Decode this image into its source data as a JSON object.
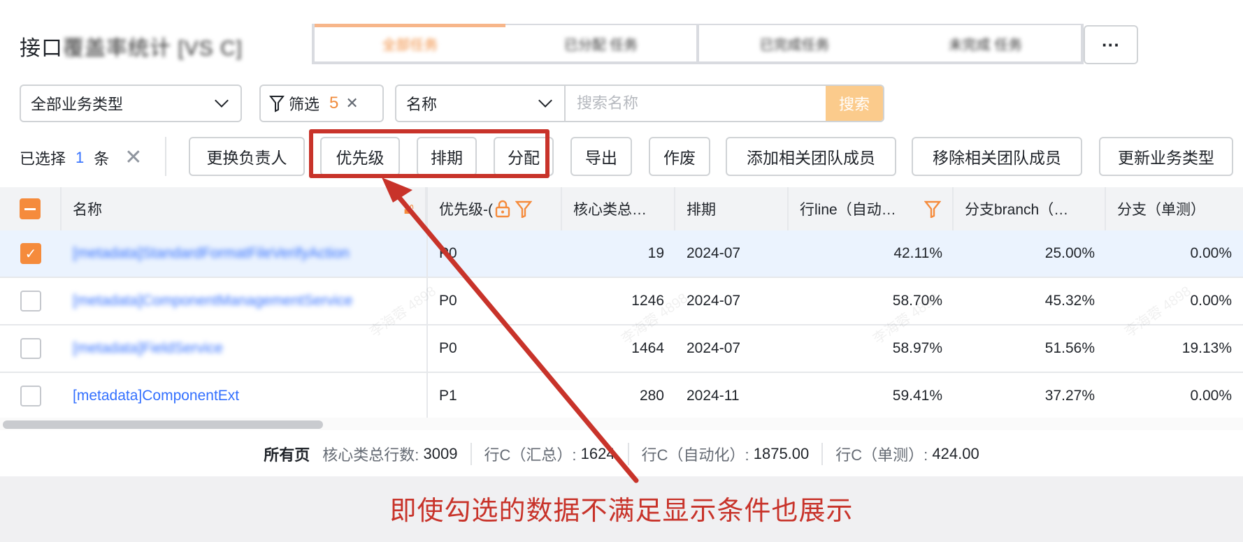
{
  "header": {
    "title_prefix": "接口",
    "title_obscured": "覆盖率统计 [VS C]",
    "tabs": [
      {
        "parts": [
          "全部任务",
          "已分配 任务"
        ]
      },
      {
        "parts": [
          "已完成任务",
          "未完成 任务"
        ]
      }
    ],
    "more_label": "···"
  },
  "filters": {
    "business_type": "全部业务类型",
    "filter_label": "筛选",
    "filter_count": "5",
    "search_field": "名称",
    "search_placeholder": "搜索名称",
    "search_button": "搜索"
  },
  "selection": {
    "prefix": "已选择",
    "count": "1",
    "suffix": "条",
    "actions": [
      "更换负责人",
      "优先级",
      "排期",
      "分配",
      "导出",
      "作废",
      "添加相关团队成员",
      "移除相关团队成员",
      "更新业务类型"
    ]
  },
  "table": {
    "columns": [
      "名称",
      "优先级-(",
      "核心类总…",
      "排期",
      "行line（自动…",
      "分支branch（…",
      "分支（单测）"
    ],
    "rows": [
      {
        "name": "[metadata]StandardFormatFileVerifyAction",
        "priority": "P0",
        "core": "19",
        "schedule": "2024-07",
        "line": "42.11%",
        "branch": "25.00%",
        "unit": "0.00%",
        "checked": true
      },
      {
        "name": "[metadata]ComponentManagementService",
        "priority": "P0",
        "core": "1246",
        "schedule": "2024-07",
        "line": "58.70%",
        "branch": "45.32%",
        "unit": "0.00%",
        "checked": false
      },
      {
        "name": "[metadata]FieldService",
        "priority": "P0",
        "core": "1464",
        "schedule": "2024-07",
        "line": "58.97%",
        "branch": "51.56%",
        "unit": "19.13%",
        "checked": false
      },
      {
        "name": "[metadata]ComponentExt",
        "priority": "P1",
        "core": "280",
        "schedule": "2024-11",
        "line": "59.41%",
        "branch": "37.27%",
        "unit": "0.00%",
        "checked": false
      }
    ]
  },
  "summary": {
    "label": "所有页",
    "items": [
      {
        "key": "核心类总行数:",
        "value": "3009"
      },
      {
        "key": "行C（汇总）:",
        "value": "1624"
      },
      {
        "key": "行C（自动化）:",
        "value": "1875.00"
      },
      {
        "key": "行C（单测）:",
        "value": "424.00"
      }
    ]
  },
  "annotation": {
    "text": "即使勾选的数据不满足显示条件也展示",
    "color": "#c8332a"
  },
  "watermark": "李海蓉 4898",
  "colors": {
    "accent": "#f58b3c",
    "link": "#3370ff",
    "annotation": "#c8332a"
  }
}
